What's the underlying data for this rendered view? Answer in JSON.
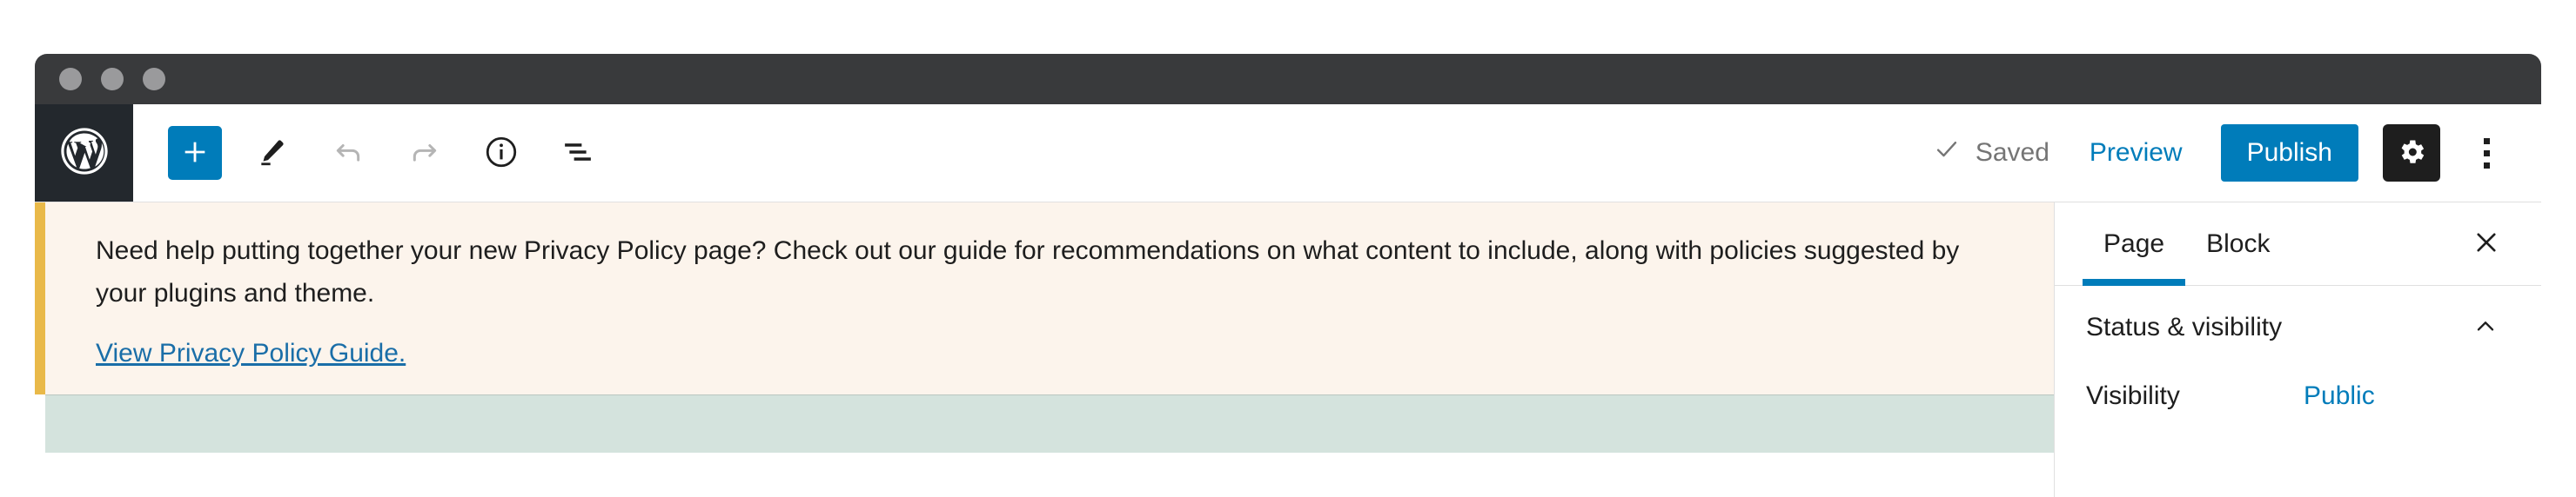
{
  "window": {
    "traffic_lights": [
      "close",
      "minimize",
      "zoom"
    ]
  },
  "header": {
    "logo": "wordpress-logo-icon",
    "tools": [
      {
        "name": "add-block",
        "icon": "plus-icon",
        "label": "+"
      },
      {
        "name": "edit-tool",
        "icon": "pencil-icon"
      },
      {
        "name": "undo",
        "icon": "undo-arrow-icon"
      },
      {
        "name": "redo",
        "icon": "redo-arrow-icon"
      },
      {
        "name": "details",
        "icon": "info-circle-icon"
      },
      {
        "name": "list-view",
        "icon": "list-view-icon"
      }
    ],
    "saved_label": "Saved",
    "saved_icon": "checkmark-icon",
    "preview_label": "Preview",
    "publish_label": "Publish",
    "settings_icon": "gear-icon",
    "more_menu_icon": "vertical-ellipsis-icon"
  },
  "notice": {
    "text": "Need help putting together your new Privacy Policy page? Check out our guide for recommendations on what content to include, along with policies suggested by your plugins and theme.",
    "link_label": "View Privacy Policy Guide.",
    "accent_color": "#e9b949",
    "background_color": "#fcf4ec"
  },
  "content": {
    "placeholder_block_color": "#d4e3dd"
  },
  "sidebar": {
    "tabs": [
      {
        "label": "Page",
        "active": true
      },
      {
        "label": "Block",
        "active": false
      }
    ],
    "close_icon": "close-x-icon",
    "panels": [
      {
        "title": "Status & visibility",
        "toggle_icon": "chevron-up-icon",
        "rows": [
          {
            "label": "Visibility",
            "value": "Public"
          }
        ]
      }
    ]
  },
  "colors": {
    "accent": "#007cba",
    "link": "#1a6ea8",
    "chrome": "#393a3c",
    "wp_logo_bg": "#23282d",
    "dark_button": "#1e1e1e"
  }
}
